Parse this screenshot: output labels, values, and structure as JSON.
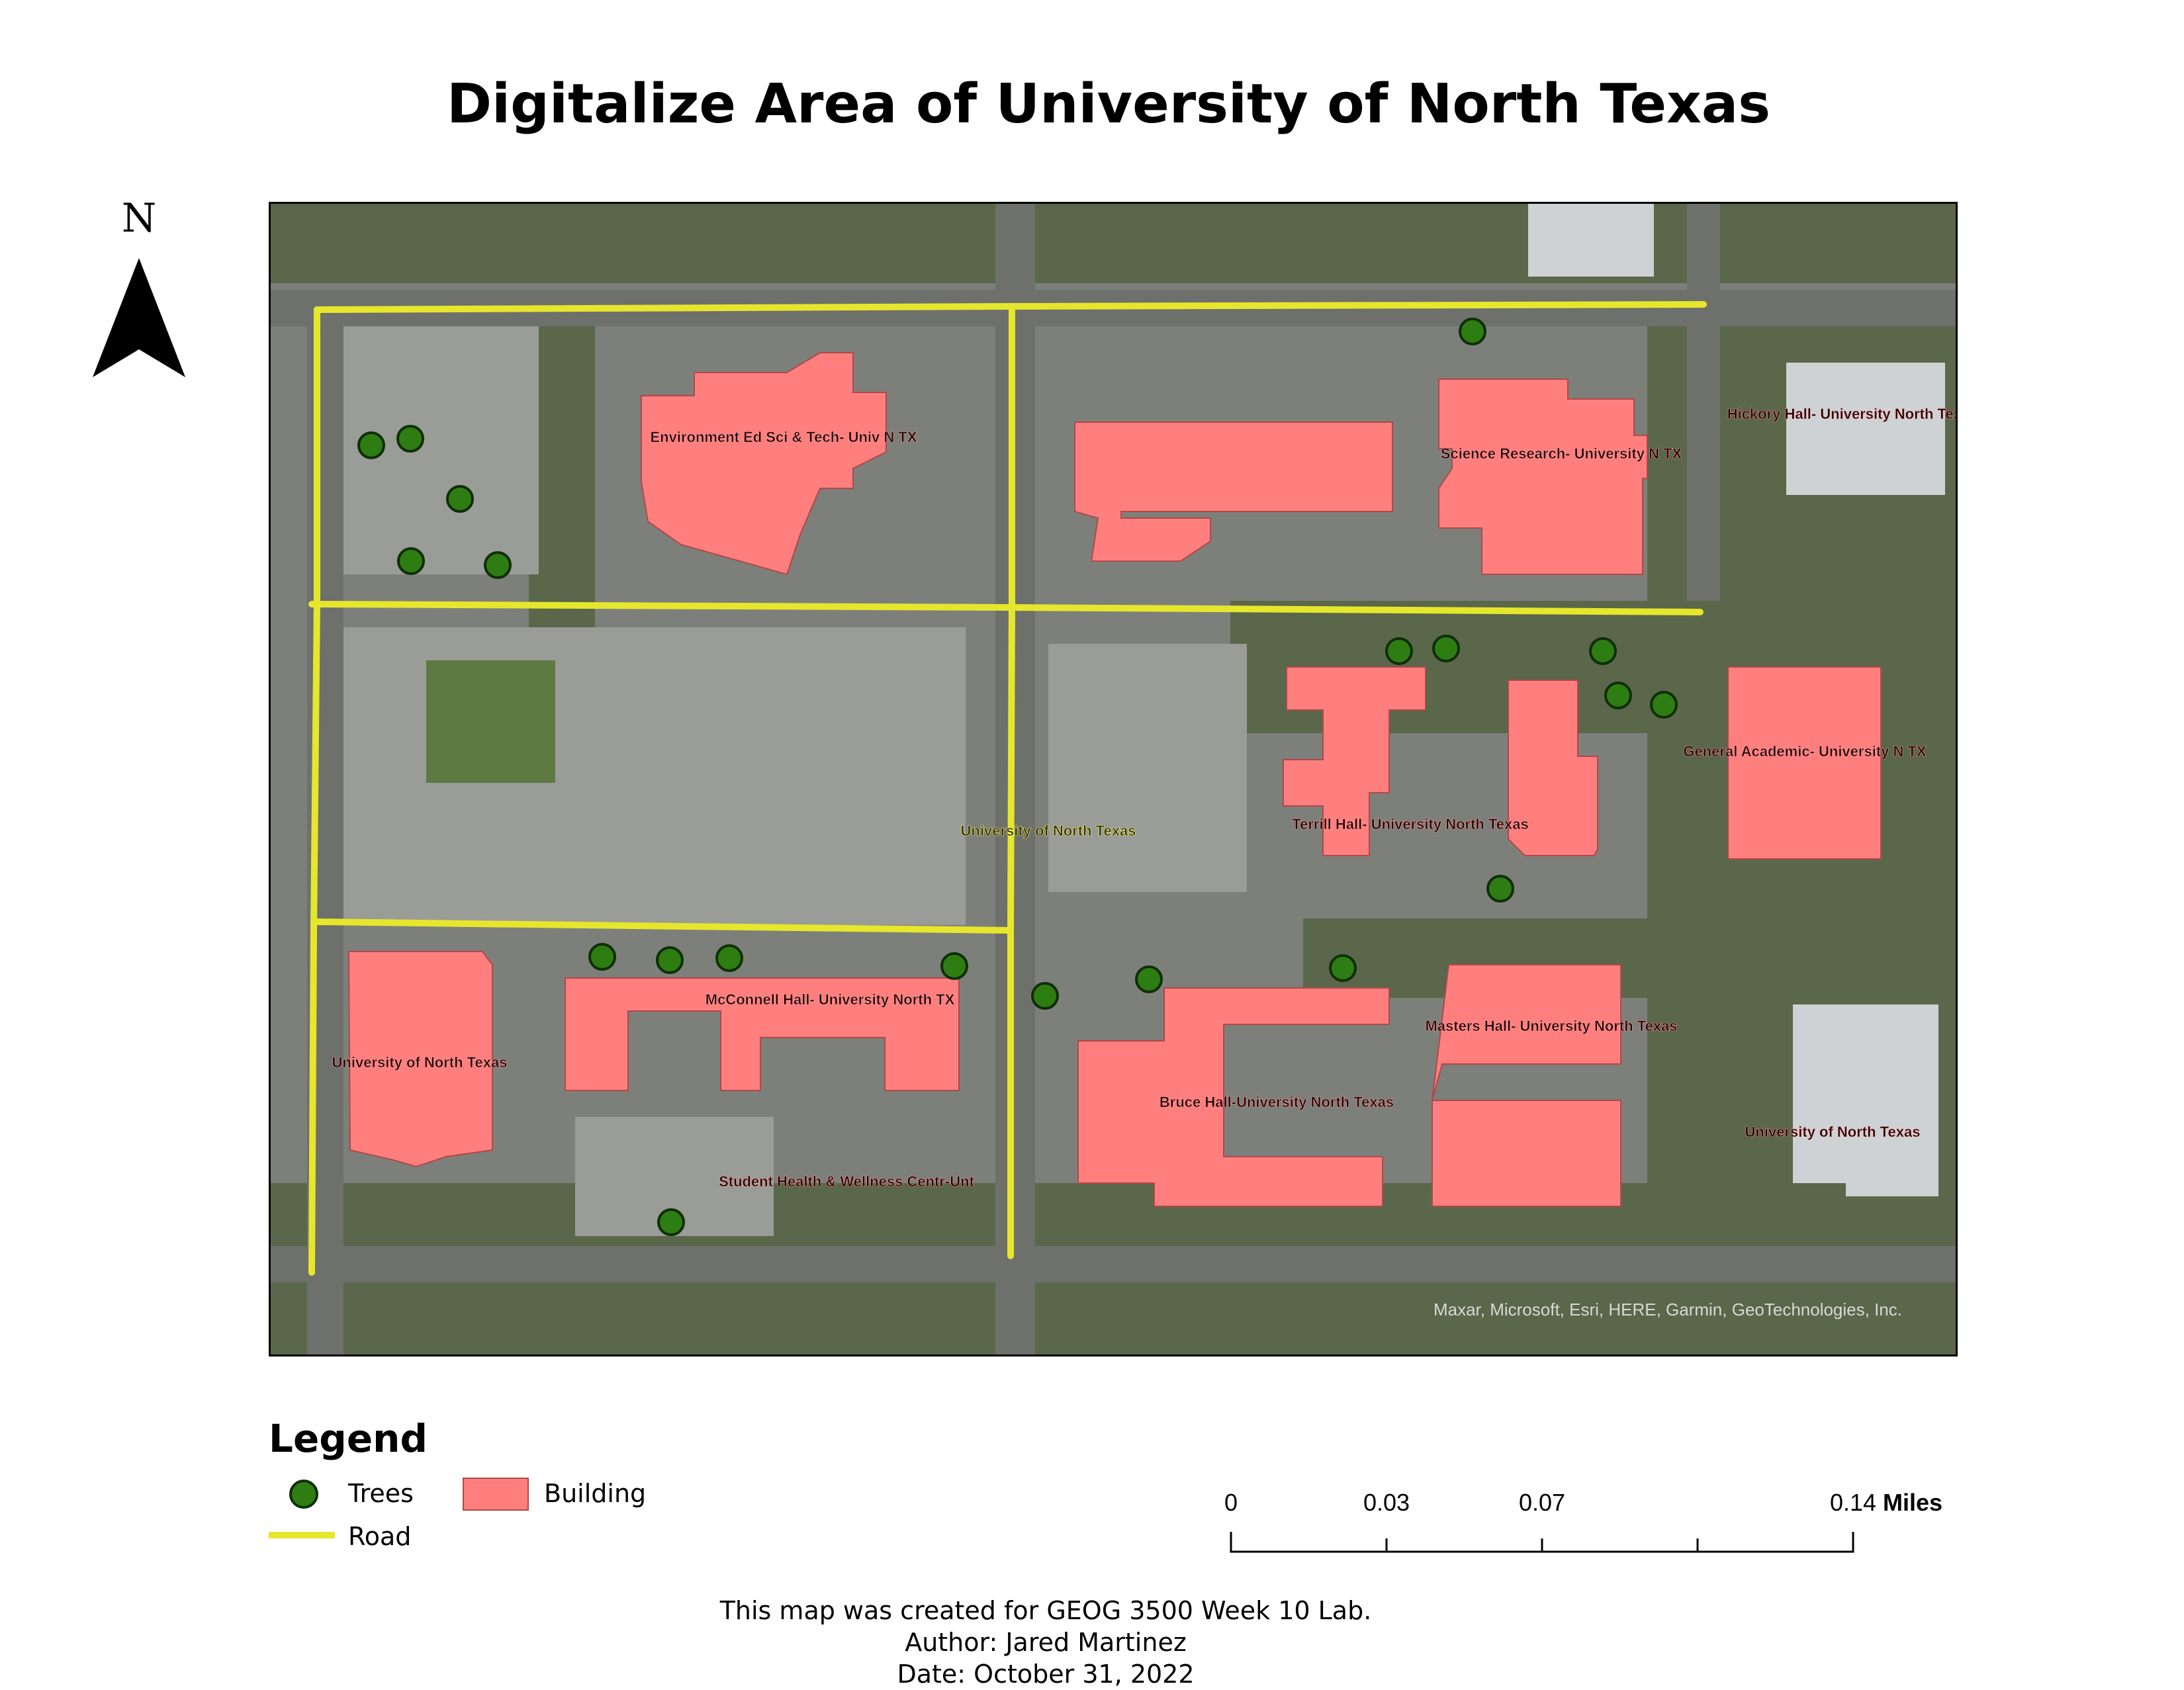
{
  "title": "Digitalize Area of University of North Texas",
  "north_arrow": {
    "letter": "N"
  },
  "map": {
    "attribution": "Maxar, Microsoft, Esri, HERE, Garmin, GeoTechnologies, Inc.",
    "building_labels": [
      "Environment Ed Sci & Tech- Univ N TX",
      "Science Research- University N TX",
      "Hickory Hall- University North Texas",
      "General Academic- University N TX",
      "Terrill Hall- University North Texas",
      "University of North Texas",
      "McConnell Hall- University North TX",
      "University of North Texas",
      "Student Health & Wellness Centr-Unt",
      "Bruce Hall-University North Texas",
      "Masters Hall- University North Texas",
      "University of North Texas"
    ],
    "colors": {
      "building": "#ff7f7f",
      "road": "#e6e62d",
      "tree": "#2e7d12",
      "imagery": "#7c7f78"
    }
  },
  "legend": {
    "title": "Legend",
    "items": [
      {
        "label": "Trees",
        "icon": "tree-circle-icon"
      },
      {
        "label": "Building",
        "icon": "building-swatch-icon"
      },
      {
        "label": "Road",
        "icon": "road-line-icon"
      }
    ]
  },
  "scalebar": {
    "ticks": [
      "0",
      "0.03",
      "0.07",
      "0.14"
    ],
    "units": "Miles"
  },
  "credits": {
    "line1": "This map was created for GEOG 3500 Week 10 Lab.",
    "line2": "Author:  Jared Martinez",
    "line3": "Date: October 31, 2022"
  }
}
